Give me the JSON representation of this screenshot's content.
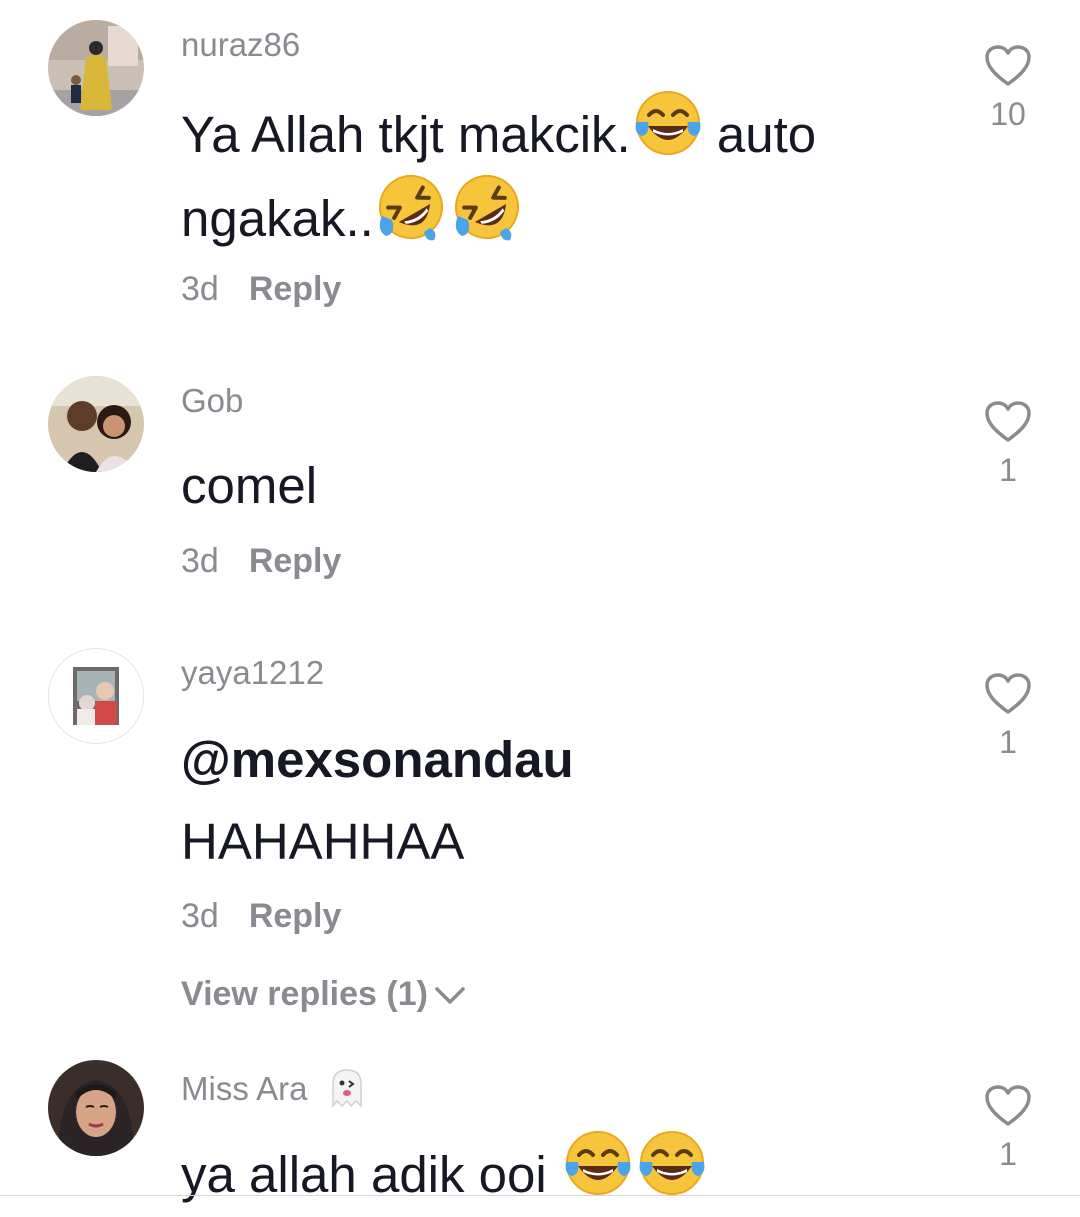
{
  "comments": [
    {
      "username": "nuraz86",
      "text_line1": "Ya Allah tkjt makcik.",
      "text_line1_tail": " auto",
      "text_line2": "ngakak..",
      "age": "3d",
      "reply_label": "Reply",
      "likes": "10",
      "emoji": [
        "face-with-tears-of-joy",
        "rolling-on-floor-laughing",
        "rolling-on-floor-laughing"
      ]
    },
    {
      "username": "Gob",
      "text_line1": "comel",
      "age": "3d",
      "reply_label": "Reply",
      "likes": "1"
    },
    {
      "username": "yaya1212",
      "text_line1": "@mexsonandau",
      "text_line2": "HAHAHHAA",
      "age": "3d",
      "reply_label": "Reply",
      "likes": "1",
      "view_replies": "View replies (1)"
    },
    {
      "username": "Miss Ara",
      "username_emoji": "ghost",
      "text_line1": "ya allah adik ooi ",
      "age": "",
      "likes": "1",
      "emoji": [
        "face-with-tears-of-joy",
        "face-with-tears-of-joy"
      ]
    }
  ],
  "icons": {
    "like": "heart-outline-icon",
    "expand": "chevron-down-icon"
  },
  "colors": {
    "primary_text": "#161823",
    "secondary_text": "#8a8b91",
    "emoji_yellow": "#f7c53b"
  }
}
